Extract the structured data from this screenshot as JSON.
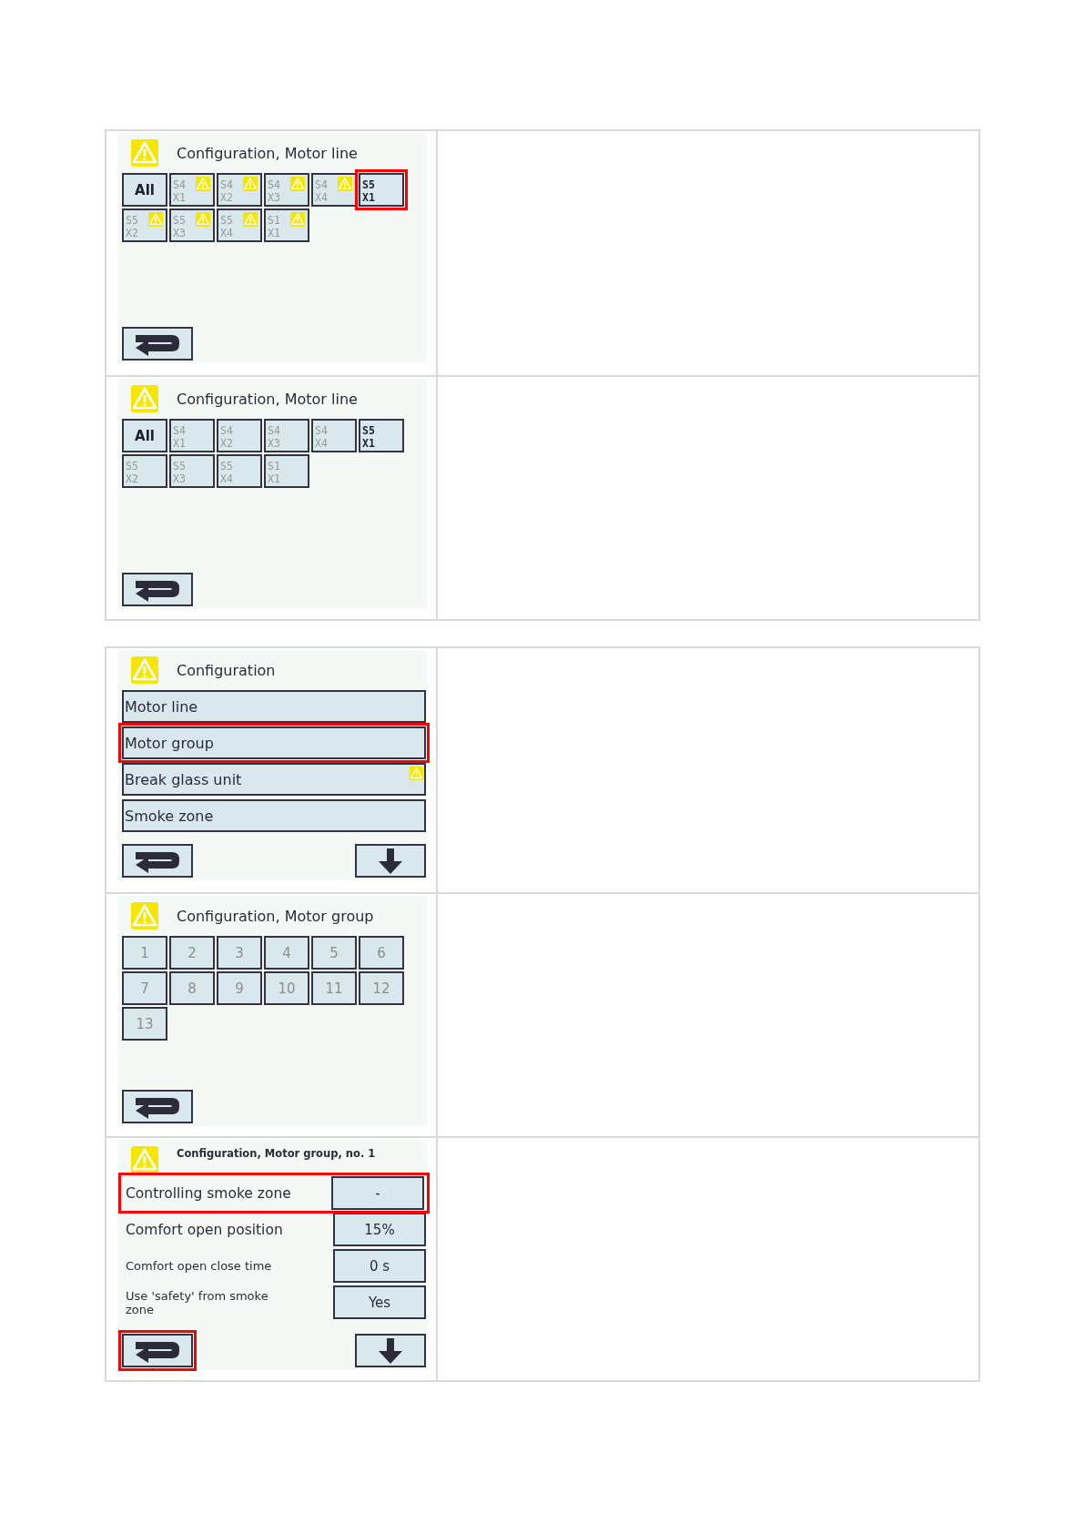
{
  "sections": [
    {
      "rows": [
        {
          "screen": {
            "kind": "grid",
            "title": "Configuration, Motor line",
            "warning": true,
            "buttons": [
              {
                "lines": [
                  "All"
                ],
                "enabled": true,
                "warning": false,
                "highlighted": false
              },
              {
                "lines": [
                  "S4",
                  "X1"
                ],
                "enabled": false,
                "warning": true,
                "highlighted": false
              },
              {
                "lines": [
                  "S4",
                  "X2"
                ],
                "enabled": false,
                "warning": true,
                "highlighted": false
              },
              {
                "lines": [
                  "S4",
                  "X3"
                ],
                "enabled": false,
                "warning": true,
                "highlighted": false
              },
              {
                "lines": [
                  "S4",
                  "X4"
                ],
                "enabled": false,
                "warning": true,
                "highlighted": false
              },
              {
                "lines": [
                  "S5",
                  "X1"
                ],
                "enabled": true,
                "warning": false,
                "highlighted": true
              },
              {
                "lines": [
                  "S5",
                  "X2"
                ],
                "enabled": false,
                "warning": true,
                "highlighted": false
              },
              {
                "lines": [
                  "S5",
                  "X3"
                ],
                "enabled": false,
                "warning": true,
                "highlighted": false
              },
              {
                "lines": [
                  "S5",
                  "X4"
                ],
                "enabled": false,
                "warning": true,
                "highlighted": false
              },
              {
                "lines": [
                  "S1",
                  "X1"
                ],
                "enabled": false,
                "warning": true,
                "highlighted": false
              }
            ],
            "back": {
              "highlighted": false
            }
          }
        },
        {
          "screen": {
            "kind": "grid",
            "title": "Configuration, Motor line",
            "warning": true,
            "buttons": [
              {
                "lines": [
                  "All"
                ],
                "enabled": true,
                "warning": false,
                "highlighted": false
              },
              {
                "lines": [
                  "S4",
                  "X1"
                ],
                "enabled": false,
                "warning": false,
                "highlighted": false
              },
              {
                "lines": [
                  "S4",
                  "X2"
                ],
                "enabled": false,
                "warning": false,
                "highlighted": false
              },
              {
                "lines": [
                  "S4",
                  "X3"
                ],
                "enabled": false,
                "warning": false,
                "highlighted": false
              },
              {
                "lines": [
                  "S4",
                  "X4"
                ],
                "enabled": false,
                "warning": false,
                "highlighted": false
              },
              {
                "lines": [
                  "S5",
                  "X1"
                ],
                "enabled": true,
                "warning": false,
                "highlighted": false
              },
              {
                "lines": [
                  "S5",
                  "X2"
                ],
                "enabled": false,
                "warning": false,
                "highlighted": false
              },
              {
                "lines": [
                  "S5",
                  "X3"
                ],
                "enabled": false,
                "warning": false,
                "highlighted": false
              },
              {
                "lines": [
                  "S5",
                  "X4"
                ],
                "enabled": false,
                "warning": false,
                "highlighted": false
              },
              {
                "lines": [
                  "S1",
                  "X1"
                ],
                "enabled": false,
                "warning": false,
                "highlighted": false
              }
            ],
            "back": {
              "highlighted": false
            }
          }
        }
      ]
    },
    {
      "rows": [
        {
          "screen": {
            "kind": "menu",
            "title": "Configuration",
            "warning": true,
            "items": [
              {
                "label": "Motor line",
                "warning": false,
                "highlighted": false
              },
              {
                "label": "Motor group",
                "warning": false,
                "highlighted": true
              },
              {
                "label": "Break glass unit",
                "warning": true,
                "highlighted": false
              },
              {
                "label": "Smoke zone",
                "warning": false,
                "highlighted": false
              }
            ],
            "back": {
              "highlighted": false
            },
            "down": true
          }
        },
        {
          "screen": {
            "kind": "numbers",
            "title": "Configuration, Motor group",
            "warning": true,
            "buttons": [
              {
                "lines": [
                  "1"
                ],
                "enabled": false,
                "warning": false,
                "highlighted": false
              },
              {
                "lines": [
                  "2"
                ],
                "enabled": false,
                "warning": false,
                "highlighted": false
              },
              {
                "lines": [
                  "3"
                ],
                "enabled": false,
                "warning": false,
                "highlighted": false
              },
              {
                "lines": [
                  "4"
                ],
                "enabled": false,
                "warning": false,
                "highlighted": false
              },
              {
                "lines": [
                  "5"
                ],
                "enabled": false,
                "warning": false,
                "highlighted": false
              },
              {
                "lines": [
                  "6"
                ],
                "enabled": false,
                "warning": false,
                "highlighted": false
              },
              {
                "lines": [
                  "7"
                ],
                "enabled": false,
                "warning": false,
                "highlighted": false
              },
              {
                "lines": [
                  "8"
                ],
                "enabled": false,
                "warning": false,
                "highlighted": false
              },
              {
                "lines": [
                  "9"
                ],
                "enabled": false,
                "warning": false,
                "highlighted": false
              },
              {
                "lines": [
                  "10"
                ],
                "enabled": false,
                "warning": false,
                "highlighted": false
              },
              {
                "lines": [
                  "11"
                ],
                "enabled": false,
                "warning": false,
                "highlighted": false
              },
              {
                "lines": [
                  "12"
                ],
                "enabled": false,
                "warning": false,
                "highlighted": false
              },
              {
                "lines": [
                  "13"
                ],
                "enabled": false,
                "warning": false,
                "highlighted": false
              }
            ],
            "back": {
              "highlighted": false
            }
          }
        },
        {
          "screen": {
            "kind": "settings",
            "title": "Configuration, Motor group, no. 1",
            "warning": true,
            "rows": [
              {
                "label": "Controlling smoke zone",
                "value": "-",
                "highlighted": true
              },
              {
                "label": "Comfort open position",
                "value": "15%",
                "highlighted": false
              },
              {
                "label": "Comfort open close time",
                "value": "0 s",
                "highlighted": false
              },
              {
                "label": "Use 'safety' from smoke zone",
                "value": "Yes",
                "highlighted": false
              }
            ],
            "back": {
              "highlighted": true
            },
            "down": true
          }
        }
      ]
    }
  ]
}
